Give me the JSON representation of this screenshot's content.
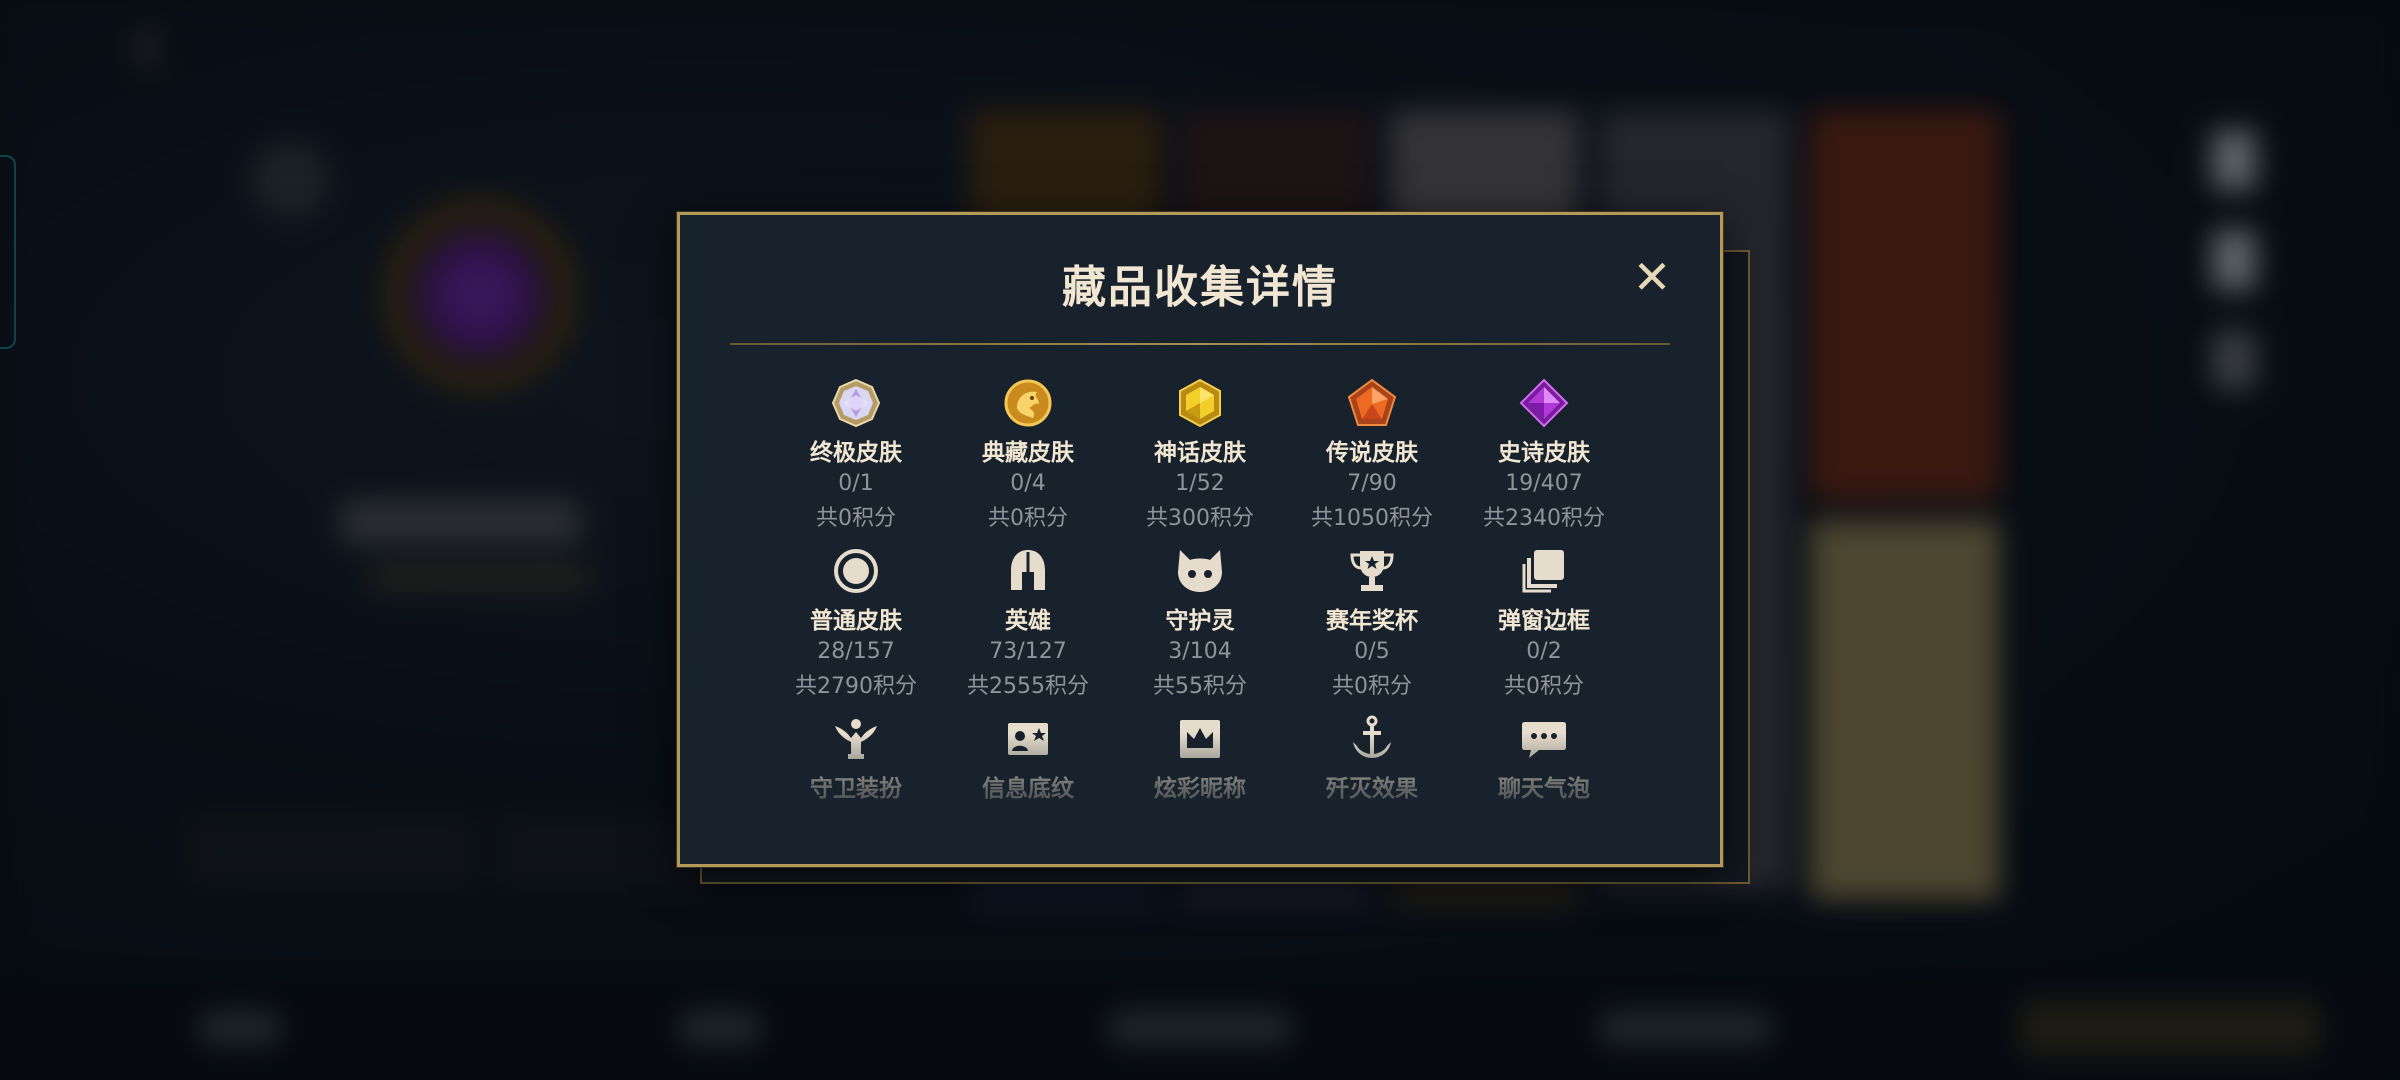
{
  "modal": {
    "title": "藏品收集详情",
    "close_symbol": "✕"
  },
  "collection": [
    [
      {
        "icon": "ultimate-skin-gem-icon",
        "label": "终极皮肤",
        "count": "0/1",
        "points": "共0积分"
      },
      {
        "icon": "collectors-skin-dragon-icon",
        "label": "典藏皮肤",
        "count": "0/4",
        "points": "共0积分"
      },
      {
        "icon": "mythic-skin-gem-icon",
        "label": "神话皮肤",
        "count": "1/52",
        "points": "共300积分"
      },
      {
        "icon": "legendary-skin-gem-icon",
        "label": "传说皮肤",
        "count": "7/90",
        "points": "共1050积分"
      },
      {
        "icon": "epic-skin-gem-icon",
        "label": "史诗皮肤",
        "count": "19/407",
        "points": "共2340积分"
      }
    ],
    [
      {
        "icon": "normal-skin-circle-icon",
        "label": "普通皮肤",
        "count": "28/157",
        "points": "共2790积分"
      },
      {
        "icon": "champion-helmet-icon",
        "label": "英雄",
        "count": "73/127",
        "points": "共2555积分"
      },
      {
        "icon": "little-legend-icon",
        "label": "守护灵",
        "count": "3/104",
        "points": "共55积分"
      },
      {
        "icon": "season-trophy-icon",
        "label": "赛年奖杯",
        "count": "0/5",
        "points": "共0积分"
      },
      {
        "icon": "popup-frame-icon",
        "label": "弹窗边框",
        "count": "0/2",
        "points": "共0积分"
      }
    ],
    [
      {
        "icon": "ward-skin-icon",
        "label": "守卫装扮",
        "count": "",
        "points": ""
      },
      {
        "icon": "info-card-icon",
        "label": "信息底纹",
        "count": "",
        "points": ""
      },
      {
        "icon": "fancy-nickname-icon",
        "label": "炫彩昵称",
        "count": "",
        "points": ""
      },
      {
        "icon": "finisher-effect-icon",
        "label": "歼灭效果",
        "count": "",
        "points": ""
      },
      {
        "icon": "chat-bubble-icon",
        "label": "聊天气泡",
        "count": "",
        "points": ""
      }
    ]
  ],
  "colors": {
    "modal_border": "#b49a5a",
    "modal_bg": "#18222c",
    "label": "#f0e6d2",
    "subtext": "#8e949a"
  }
}
